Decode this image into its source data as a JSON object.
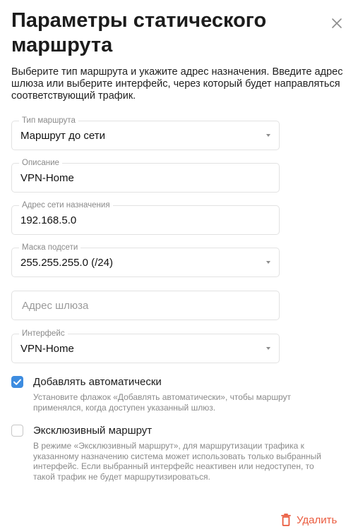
{
  "dialog": {
    "title": "Параметры статического маршрута",
    "description": "Выберите тип маршрута и укажите адрес назначения. Введите адрес шлюза или выберите интерфейс, через который будет направляться соответствующий трафик."
  },
  "fields": {
    "route_type": {
      "label": "Тип маршрута",
      "value": "Маршрут до сети"
    },
    "description": {
      "label": "Описание",
      "value": "VPN-Home"
    },
    "destination": {
      "label": "Адрес сети назначения",
      "value": "192.168.5.0"
    },
    "mask": {
      "label": "Маска подсети",
      "value": "255.255.255.0 (/24)"
    },
    "gateway": {
      "placeholder": "Адрес шлюза",
      "value": ""
    },
    "interface": {
      "label": "Интерфейс",
      "value": "VPN-Home"
    }
  },
  "options": {
    "auto_add": {
      "checked": true,
      "label": "Добавлять автоматически",
      "help": "Установите флажок «Добавлять автоматически», чтобы маршрут применялся, когда доступен указанный шлюз."
    },
    "exclusive": {
      "checked": false,
      "label": "Эксклюзивный маршрут",
      "help": "В режиме «Эксклюзивный маршрут», для маршрутизации трафика к указанному назначению система может использовать только выбранный интерфейс. Если выбранный интерфейс неактивен или недоступен, то такой трафик не будет маршрутизироваться."
    }
  },
  "actions": {
    "delete_label": "Удалить"
  },
  "icons": {
    "close": "close-icon",
    "delete": "trash-icon",
    "check": "check-icon",
    "dropdown": "chevron-down-icon"
  },
  "colors": {
    "accent": "#3d8ce0",
    "danger": "#ea5a3d",
    "muted": "#8a8a8a"
  }
}
